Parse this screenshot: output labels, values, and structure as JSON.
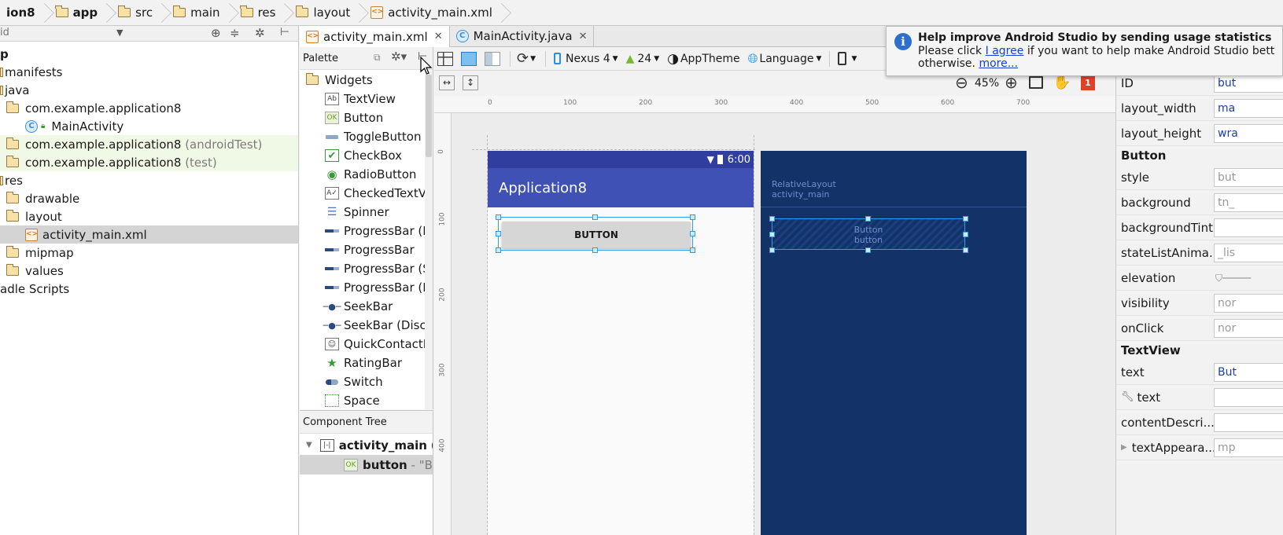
{
  "breadcrumb": [
    "ion8",
    "app",
    "src",
    "main",
    "res",
    "layout",
    "activity_main.xml"
  ],
  "project": {
    "dropdown": "id",
    "items": [
      {
        "label": "p",
        "note": ""
      },
      {
        "label": "manifests",
        "note": ""
      },
      {
        "label": "java",
        "note": ""
      },
      {
        "label": "com.example.application8",
        "note": ""
      },
      {
        "label": "MainActivity",
        "note": ""
      },
      {
        "label": "com.example.application8",
        "note": "(androidTest)"
      },
      {
        "label": "com.example.application8",
        "note": "(test)"
      },
      {
        "label": "res",
        "note": ""
      },
      {
        "label": "drawable",
        "note": ""
      },
      {
        "label": "layout",
        "note": ""
      },
      {
        "label": "activity_main.xml",
        "note": ""
      },
      {
        "label": "mipmap",
        "note": ""
      },
      {
        "label": "values",
        "note": ""
      },
      {
        "label": "adle Scripts",
        "note": ""
      }
    ]
  },
  "tabs": [
    "activity_main.xml",
    "MainActivity.java"
  ],
  "palette": {
    "title": "Palette",
    "group": "Widgets",
    "items": [
      "TextView",
      "Button",
      "ToggleButton",
      "CheckBox",
      "RadioButton",
      "CheckedTextView",
      "Spinner",
      "ProgressBar (Large)",
      "ProgressBar",
      "ProgressBar (Small)",
      "ProgressBar (Horizontal)",
      "SeekBar",
      "SeekBar (Discrete)",
      "QuickContactBadge",
      "RatingBar",
      "Switch",
      "Space"
    ]
  },
  "component_tree": {
    "title": "Component Tree",
    "root": "activity_main",
    "root_note": "(R",
    "child": "button",
    "child_note": "- \"But"
  },
  "toolbar": {
    "device": "Nexus 4",
    "api": "24",
    "theme": "AppTheme",
    "language": "Language",
    "zoom": "45%",
    "error_count": "1"
  },
  "ruler": {
    "top": [
      "0",
      "100",
      "200",
      "300",
      "400",
      "500",
      "600",
      "700"
    ],
    "left": [
      "0",
      "100",
      "200",
      "300",
      "400"
    ]
  },
  "preview": {
    "time": "6:00",
    "app_title": "Application8",
    "button_text": "BUTTON"
  },
  "blueprint": {
    "layout_type": "RelativeLayout",
    "layout_id": "activity_main",
    "button_type": "Button",
    "button_id": "button"
  },
  "properties": {
    "rows1": [
      {
        "name": "ID",
        "value": "but"
      },
      {
        "name": "layout_width",
        "value": "ma"
      },
      {
        "name": "layout_height",
        "value": "wra"
      }
    ],
    "section_button": "Button",
    "rows2": [
      {
        "name": "style",
        "value": "but"
      },
      {
        "name": "background",
        "value": "tn_"
      },
      {
        "name": "backgroundTint",
        "value": ""
      },
      {
        "name": "stateListAnima...",
        "value": "_lis"
      },
      {
        "name": "elevation",
        "value": ""
      },
      {
        "name": "visibility",
        "value": "nor"
      },
      {
        "name": "onClick",
        "value": "nor"
      }
    ],
    "section_textview": "TextView",
    "rows3": [
      {
        "name": "text",
        "value": "But"
      },
      {
        "name": "text",
        "value": ""
      },
      {
        "name": "contentDescri...",
        "value": ""
      },
      {
        "name": "textAppeara...",
        "value": "mp"
      }
    ]
  },
  "notification": {
    "title": "Help improve Android Studio by sending usage statistics",
    "line1_pre": "Please click",
    "link": "I agree",
    "line1_post": "if you want to help make Android Studio bett",
    "line2_pre": "otherwise.",
    "line2_link": "more..."
  },
  "colors": {
    "primary": "#3f51b5",
    "primary_dark": "#303f9f",
    "blueprint": "#133268",
    "selection": "#2e9ee8",
    "error": "#e0412b"
  }
}
